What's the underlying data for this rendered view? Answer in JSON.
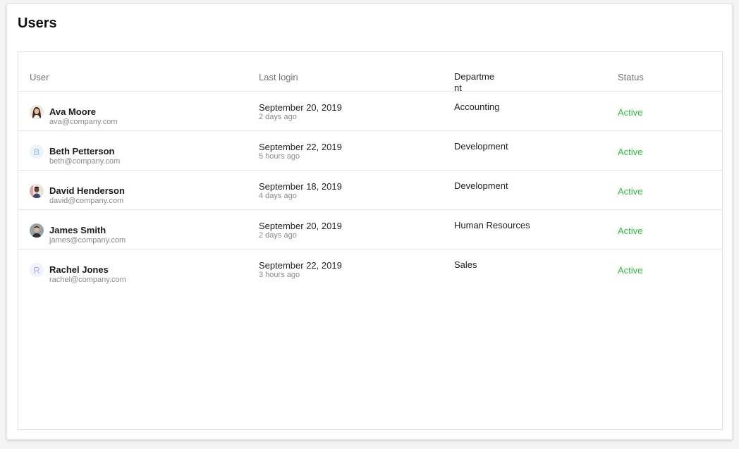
{
  "page": {
    "title": "Users"
  },
  "table": {
    "headers": {
      "user": "User",
      "last_login": "Last login",
      "department": "Department",
      "status": "Status"
    },
    "rows": [
      {
        "name": "Ava Moore",
        "email": "ava@company.com",
        "login_date": "September 20, 2019",
        "login_ago": "2 days ago",
        "department": "Accounting",
        "status": "Active",
        "avatar": {
          "type": "photo",
          "icon": "woman-portrait-icon"
        }
      },
      {
        "name": "Beth Petterson",
        "email": "beth@company.com",
        "login_date": "September 22, 2019",
        "login_ago": "5 hours ago",
        "department": "Development",
        "status": "Active",
        "avatar": {
          "type": "letter",
          "letter": "B",
          "color": "#8ec5f5"
        }
      },
      {
        "name": "David Henderson",
        "email": "david@company.com",
        "login_date": "September 18, 2019",
        "login_ago": "4 days ago",
        "department": "Development",
        "status": "Active",
        "avatar": {
          "type": "photo",
          "icon": "man-portrait-icon"
        }
      },
      {
        "name": "James Smith",
        "email": "james@company.com",
        "login_date": "September 20, 2019",
        "login_ago": "2 days ago",
        "department": "Human Resources",
        "status": "Active",
        "avatar": {
          "type": "photo",
          "icon": "man-portrait-icon"
        }
      },
      {
        "name": "Rachel Jones",
        "email": "rachel@company.com",
        "login_date": "September 22, 2019",
        "login_ago": "3 hours ago",
        "department": "Sales",
        "status": "Active",
        "avatar": {
          "type": "letter",
          "letter": "R",
          "color": "#b8a8f0"
        }
      }
    ]
  },
  "colors": {
    "status_active": "#2dbb3f"
  }
}
